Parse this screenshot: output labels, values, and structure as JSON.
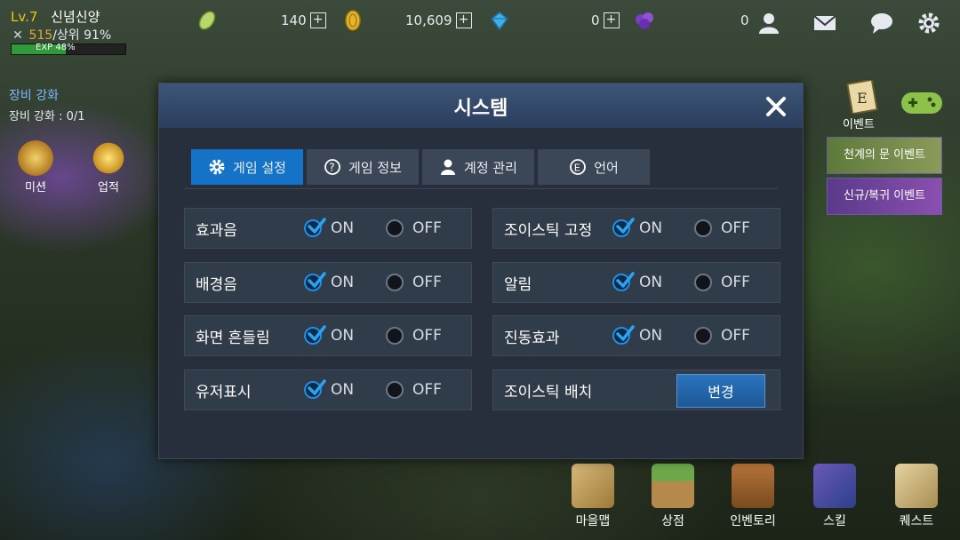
{
  "hud": {
    "level": "Lv.7",
    "player_name": "신념신양",
    "combat_value": "515",
    "rank_text": "/상위 91%",
    "exp_label": "EXP 48%",
    "exp_percent": 48,
    "currency_1": "140",
    "currency_2": "10,609",
    "currency_3": "0",
    "friends_count": "0",
    "icons": [
      "energy-icon",
      "gold-coin-icon",
      "diamond-icon",
      "purple-crystal-icon",
      "friends-icon",
      "mail-icon",
      "chat-icon",
      "settings-gear-icon"
    ]
  },
  "quest": {
    "title": "장비 강화",
    "progress": "장비 강화 : 0/1",
    "mission_label": "미션",
    "achievement_label": "업적"
  },
  "right_panel": {
    "event_label": "이벤트",
    "banner_1": "천계의 문 이벤트",
    "banner_2": "신규/복귀 이벤트"
  },
  "bottom_menu": {
    "items": [
      "마을맵",
      "상점",
      "인벤토리",
      "스킬",
      "퀘스트"
    ]
  },
  "dialog": {
    "title": "시스템",
    "tabs": [
      "게임 설정",
      "게임 정보",
      "계정 관리",
      "언어"
    ],
    "active_tab": "게임 설정",
    "on_label": "ON",
    "off_label": "OFF",
    "left_settings": [
      {
        "label": "효과음",
        "value": "ON"
      },
      {
        "label": "배경음",
        "value": "ON"
      },
      {
        "label": "화면 흔들림",
        "value": "ON"
      },
      {
        "label": "유저표시",
        "value": "ON"
      }
    ],
    "right_settings": [
      {
        "label": "조이스틱 고정",
        "value": "ON"
      },
      {
        "label": "알림",
        "value": "ON"
      },
      {
        "label": "진동효과",
        "value": "ON"
      }
    ],
    "joystick_layout": {
      "label": "조이스틱 배치",
      "button": "변경"
    }
  },
  "colors": {
    "accent": "#1473c7",
    "header": "#2b3f5e",
    "panel": "#262f3b"
  }
}
